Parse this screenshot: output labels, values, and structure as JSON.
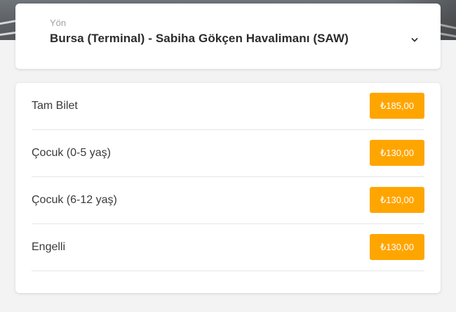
{
  "route": {
    "label": "Yön",
    "value": "Bursa (Terminal) - Sabiha Gökçen Havalimanı (SAW)",
    "dropdown_icon": "chevron-down-icon"
  },
  "prices": [
    {
      "label": "Tam Bilet",
      "price": "₺185,00"
    },
    {
      "label": "Çocuk (0-5 yaş)",
      "price": "₺130,00"
    },
    {
      "label": "Çocuk (6-12 yaş)",
      "price": "₺130,00"
    },
    {
      "label": "Engelli",
      "price": "₺130,00"
    }
  ],
  "colors": {
    "accent": "#ffa500",
    "background": "#f3f3f3",
    "card": "#ffffff"
  }
}
